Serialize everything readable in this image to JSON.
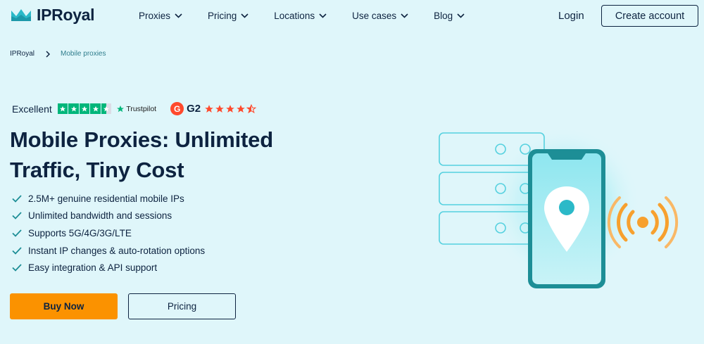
{
  "brand": {
    "name": "IPRoyal"
  },
  "nav": {
    "items": [
      {
        "label": "Proxies"
      },
      {
        "label": "Pricing"
      },
      {
        "label": "Locations"
      },
      {
        "label": "Use cases"
      },
      {
        "label": "Blog"
      }
    ],
    "login": "Login",
    "create_account": "Create account"
  },
  "breadcrumb": {
    "home": "IPRoyal",
    "current": "Mobile proxies"
  },
  "ratings": {
    "trustpilot_label": "Excellent",
    "trustpilot_brand": "Trustpilot",
    "trustpilot_stars": 4.5,
    "g2_label": "G2",
    "g2_stars": 4.5
  },
  "hero": {
    "title": "Mobile Proxies: Unlimited Traffic, Tiny Cost",
    "features": [
      "2.5M+ genuine residential mobile IPs",
      "Unlimited bandwidth and sessions",
      "Supports 5G/4G/3G/LTE",
      "Instant IP changes & auto-rotation options",
      "Easy integration & API support"
    ],
    "buy_label": "Buy Now",
    "pricing_label": "Pricing"
  },
  "colors": {
    "background": "#dff6fa",
    "text": "#0d2340",
    "accent_orange": "#fb9200",
    "trustpilot_green": "#00b67a",
    "g2_red": "#ff492c",
    "teal": "#1d8e96"
  },
  "icons": {
    "logo": "crown-icon",
    "nav_chevron": "chevron-down-icon",
    "breadcrumb_separator": "chevron-right-icon",
    "feature_bullet": "check-icon",
    "illustration": "mobile-proxy-illustration"
  }
}
